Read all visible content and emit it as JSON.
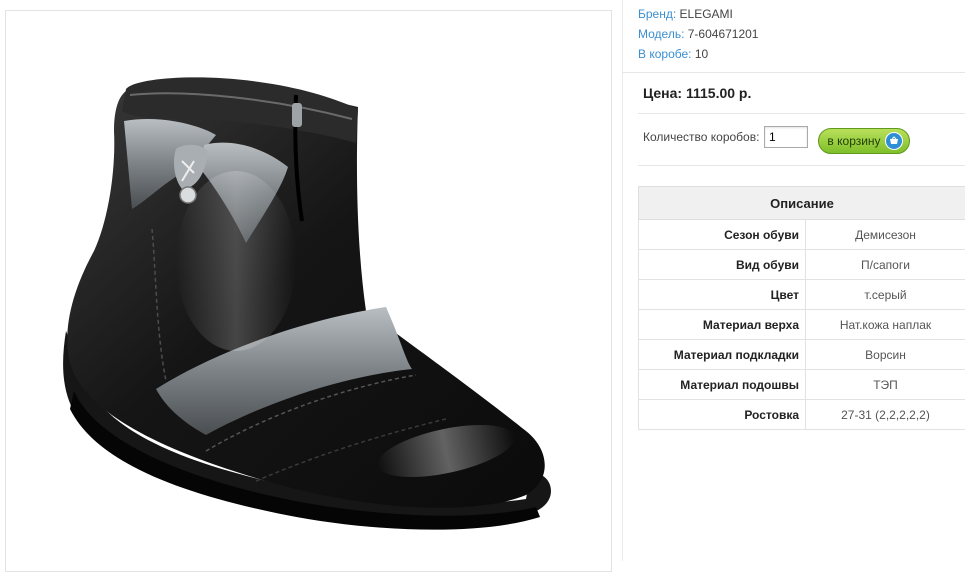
{
  "product": {
    "image_alt": "Ботинки ELEGAMI 7-604671201"
  },
  "info": {
    "brand_label": "Бренд:",
    "brand_value": "ELEGAMI",
    "model_label": "Модель:",
    "model_value": "7-604671201",
    "box_label": "В коробе:",
    "box_value": "10"
  },
  "price": {
    "text": "Цена: 1115.00 р."
  },
  "order": {
    "qty_label": "Количество коробов:",
    "qty_value": "1",
    "cart_button_label": "в корзину"
  },
  "description": {
    "title": "Описание",
    "rows": [
      {
        "key": "Сезон обуви",
        "value": "Демисезон"
      },
      {
        "key": "Вид обуви",
        "value": "П/сапоги"
      },
      {
        "key": "Цвет",
        "value": "т.серый"
      },
      {
        "key": "Материал верха",
        "value": "Нат.кожа наплак"
      },
      {
        "key": "Материал подкладки",
        "value": "Ворсин"
      },
      {
        "key": "Материал подошвы",
        "value": "ТЭП"
      },
      {
        "key": "Ростовка",
        "value": "27-31 (2,2,2,2,2)"
      }
    ]
  },
  "colors": {
    "link_blue": "#3b8fd1",
    "button_green": "#8cc63f",
    "boot_black": "#1a1a1a",
    "boot_silver": "#8a8f93"
  }
}
